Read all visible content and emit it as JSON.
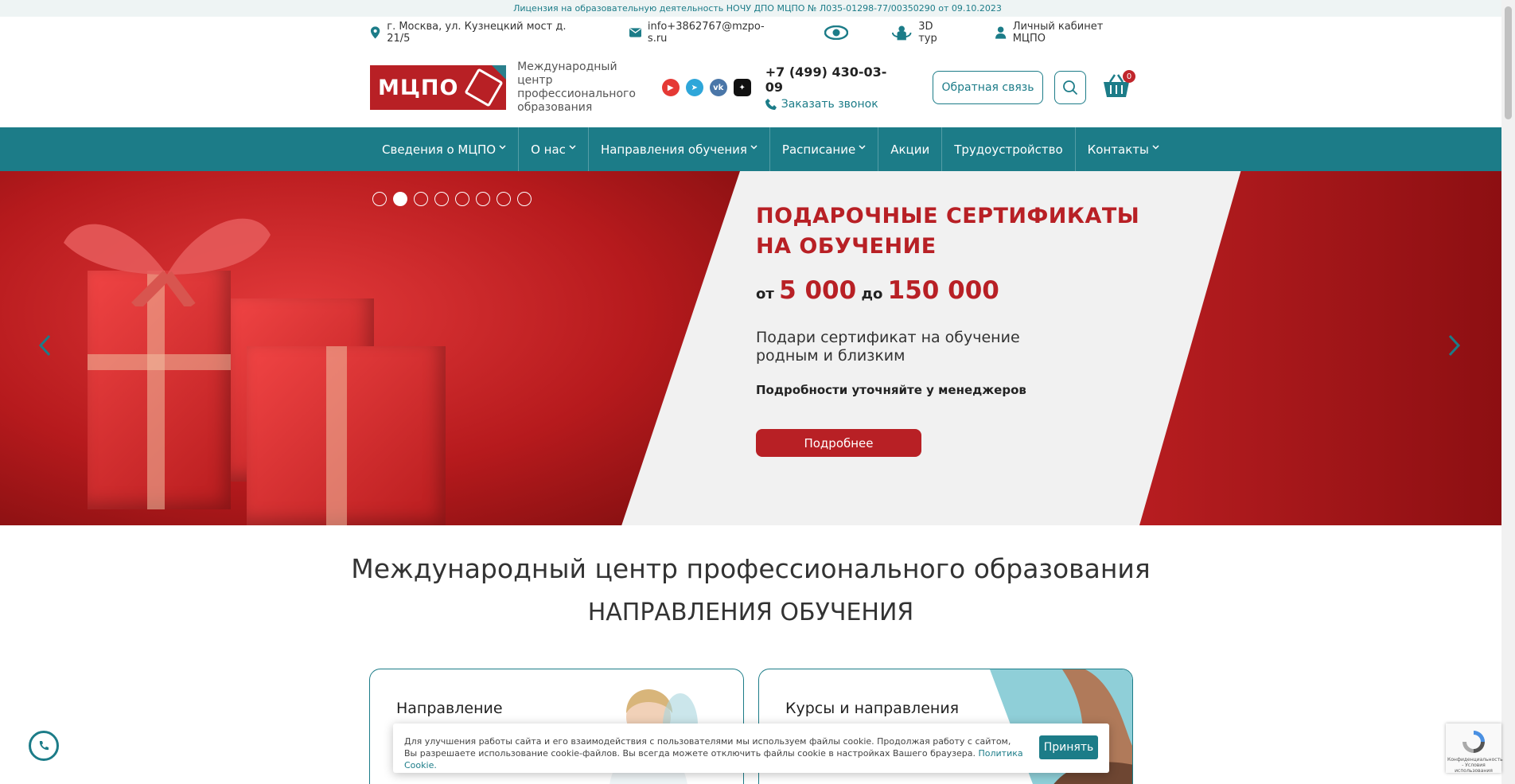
{
  "license": "Лицензия на образовательную деятельность НОЧУ ДПО МЦПО № Л035-01298-77/00350290 от 09.10.2023",
  "info": {
    "address": "г. Москва, ул. Кузнецкий мост д. 21/5",
    "email": "info+3862767@mzpo-s.ru",
    "tour": "3D тур",
    "cabinet": "Личный кабинет МЦПО"
  },
  "header": {
    "logo_text": "МЦПО",
    "tagline": "Международный центр профессионального образования",
    "phone": "+7 (499) 430-03-09",
    "callback": "Заказать звонок",
    "feedback": "Обратная связь",
    "cart_count": "0",
    "socials": [
      {
        "name": "youtube",
        "color": "#e53935"
      },
      {
        "name": "telegram",
        "color": "#2ea6d9"
      },
      {
        "name": "vk",
        "color": "#4a76a8"
      },
      {
        "name": "dzen",
        "color": "#111111"
      }
    ]
  },
  "nav": [
    {
      "label": "Сведения о МЦПО",
      "dropdown": true
    },
    {
      "label": "О нас",
      "dropdown": true
    },
    {
      "label": "Направления обучения",
      "dropdown": true
    },
    {
      "label": "Расписание",
      "dropdown": true
    },
    {
      "label": "Акции",
      "dropdown": false
    },
    {
      "label": "Трудоустройство",
      "dropdown": false
    },
    {
      "label": "Контакты",
      "dropdown": true
    }
  ],
  "slider": {
    "total": 8,
    "active": 2,
    "title_line1": "ПОДАРОЧНЫЕ СЕРТИФИКАТЫ",
    "title_line2": "НА ОБУЧЕНИЕ",
    "price_from_word": "от",
    "price_from": "5 000",
    "price_to_word": "до",
    "price_to": "150 000",
    "desc": "Подари сертификат на обучение родным и близким",
    "note": "Подробности уточняйте у менеджеров",
    "button": "Подробнее"
  },
  "main": {
    "title": "Международный центр профессионального образования",
    "subtitle": "НАПРАВЛЕНИЯ ОБУЧЕНИЯ",
    "cards": [
      {
        "label": "Направление"
      },
      {
        "label": "Курсы и направления"
      }
    ]
  },
  "cookie": {
    "text": "Для улучшения работы сайта и его взаимодействия с пользователями мы используем файлы cookie. Продолжая работу с сайтом, Вы разрешаете использование cookie-файлов. Вы всегда можете отключить файлы cookie в настройках Вашего браузера.",
    "link": "Политика Cookie.",
    "accept": "Принять"
  },
  "recaptcha": "Конфиденциальность - Условия использования",
  "colors": {
    "brand": "#1c7c88",
    "accent": "#b82025"
  }
}
